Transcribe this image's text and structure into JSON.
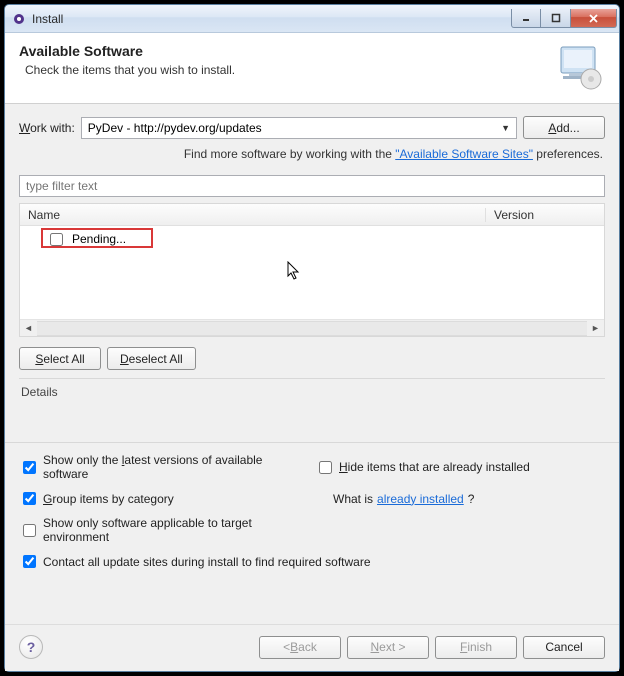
{
  "window": {
    "title": "Install"
  },
  "banner": {
    "heading": "Available Software",
    "subtext": "Check the items that you wish to install."
  },
  "work": {
    "label_pre": "W",
    "label_post": "ork with:",
    "value": "PyDev - http://pydev.org/updates",
    "add_label_pre": "A",
    "add_label_post": "dd..."
  },
  "hint": {
    "pre": "Find more software by working with the ",
    "link": "\"Available Software Sites\"",
    "post": " preferences."
  },
  "filter_placeholder": "type filter text",
  "columns": {
    "name": "Name",
    "version": "Version"
  },
  "tree": {
    "item0": "Pending..."
  },
  "buttons": {
    "select_all_u": "S",
    "select_all_rest": "elect All",
    "deselect_all_u": "D",
    "deselect_all_rest": "eselect All"
  },
  "details_label": "Details",
  "checks": {
    "latest_pre": "Show only the ",
    "latest_u": "l",
    "latest_post": "atest versions of available software",
    "group_u": "G",
    "group_post": "roup items by category",
    "target_post": "Show only software applicable to target environment",
    "contact_post": "Contact all update sites during install to find required software",
    "hide_u": "H",
    "hide_post": "ide items that are already installed",
    "whatis_pre": "What is ",
    "whatis_link": "already installed",
    "whatis_post": "?"
  },
  "footer": {
    "back_pre": "< ",
    "back_u": "B",
    "back_post": "ack",
    "next_u": "N",
    "next_post": "ext >",
    "finish_u": "F",
    "finish_post": "inish",
    "cancel": "Cancel"
  }
}
